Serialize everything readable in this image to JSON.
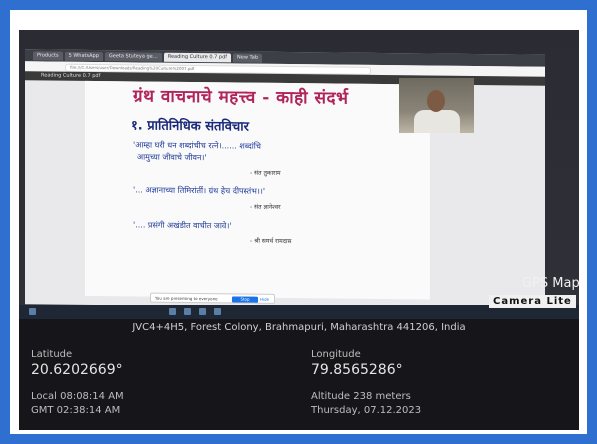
{
  "browser": {
    "tabs": [
      "Products",
      "5 WhatsApp",
      "Geeta Stuteya ge…",
      "Reading Culture 0.7 pdf",
      "New Tab"
    ],
    "address": "file:///C:/Users/user/Downloads/Reading%20Culture%2007.pdf"
  },
  "meeting": {
    "window_title": "Reading Culture 0.7 pdf"
  },
  "slide": {
    "title": "ग्रंथ वाचनाचे महत्त्व - काही संदर्भ",
    "heading": "१. प्रातिनिधिक संतविचार",
    "quotes": [
      {
        "line1": "'आम्हा घरी धन शब्दांचीच रत्ने।...... शब्दांचि",
        "line2": "आमुच्या जीवाचे जीवन।'",
        "author": "- संत तुकाराम"
      },
      {
        "line1": "'... अज्ञानाच्या तिमिरांतीं। ग्रंथ हेच दीपस्तंभ।।'",
        "line2": "",
        "author": "- संत ज्ञानेश्वर"
      },
      {
        "line1": "'.... प्रसंगी अखंडीत वाचीत जावे।'",
        "line2": "",
        "author": "- श्री समर्थ रामदास"
      }
    ]
  },
  "present_bar": {
    "text": "You are presenting to everyone",
    "stop_label": "Stop presenting",
    "hide_label": "Hide"
  },
  "gps": {
    "brand": "GPS Map",
    "sub_brand": "Camera Lite",
    "address": "JVC4+4H5, Forest Colony, Brahmapuri, Maharashtra 441206, India",
    "latitude_label": "Latitude",
    "latitude": "20.6202669°",
    "longitude_label": "Longitude",
    "longitude": "79.8565286°",
    "local_time": "Local 08:08:14 AM",
    "gmt_time": "GMT 02:38:14 AM",
    "altitude": "Altitude 238 meters",
    "date": "Thursday, 07.12.2023"
  },
  "colors": {
    "outer_frame": "#2f6fd0",
    "slide_title": "#b0245a",
    "slide_heading": "#1b2a7a"
  }
}
